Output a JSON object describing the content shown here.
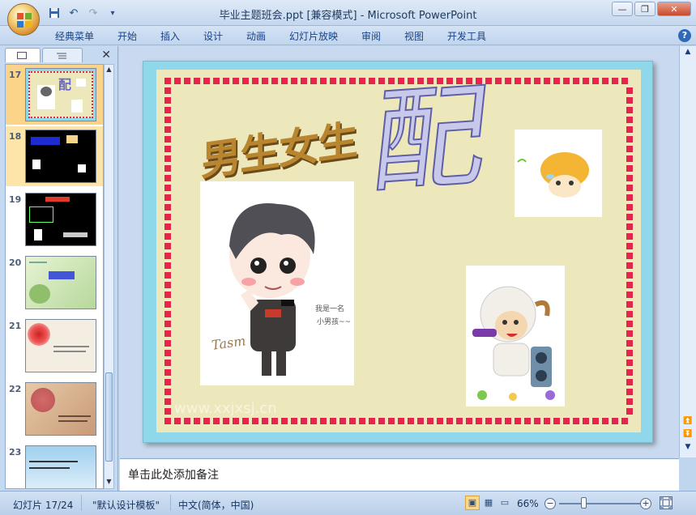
{
  "window": {
    "title": "毕业主题班会.ppt [兼容模式] - Microsoft PowerPoint",
    "minimize": "—",
    "restore": "❐",
    "close": "✕"
  },
  "qat": {
    "undo": "↶",
    "redo": "↷",
    "customize": "▾"
  },
  "menu": [
    "经典菜单",
    "开始",
    "插入",
    "设计",
    "动画",
    "幻灯片放映",
    "审阅",
    "视图",
    "开发工具"
  ],
  "help": "?",
  "pane": {
    "close": "✕",
    "slides": [
      {
        "num": "17",
        "state": "selected"
      },
      {
        "num": "18",
        "state": "hover"
      },
      {
        "num": "19",
        "state": "normal"
      },
      {
        "num": "20",
        "state": "normal"
      },
      {
        "num": "21",
        "state": "normal"
      },
      {
        "num": "22",
        "state": "normal"
      },
      {
        "num": "23",
        "state": "normal"
      }
    ]
  },
  "slide": {
    "title_left": "男生女生",
    "title_right": "配",
    "caption1": "我是一名",
    "caption2": "小男孩~~",
    "signature": "Tasm",
    "watermark": "www.xxjxsj.cn"
  },
  "notes": {
    "placeholder": "单击此处添加备注"
  },
  "status": {
    "slide_info": "幻灯片 17/24",
    "template": "\"默认设计模板\"",
    "language": "中文(简体，中国)",
    "zoom": "66%"
  },
  "colors": {
    "slide_border_frame": "#8fd7ea",
    "slide_bg": "#ede8bb",
    "border_squares": "#e5264c",
    "selected_thumb": "#fbd48a"
  }
}
